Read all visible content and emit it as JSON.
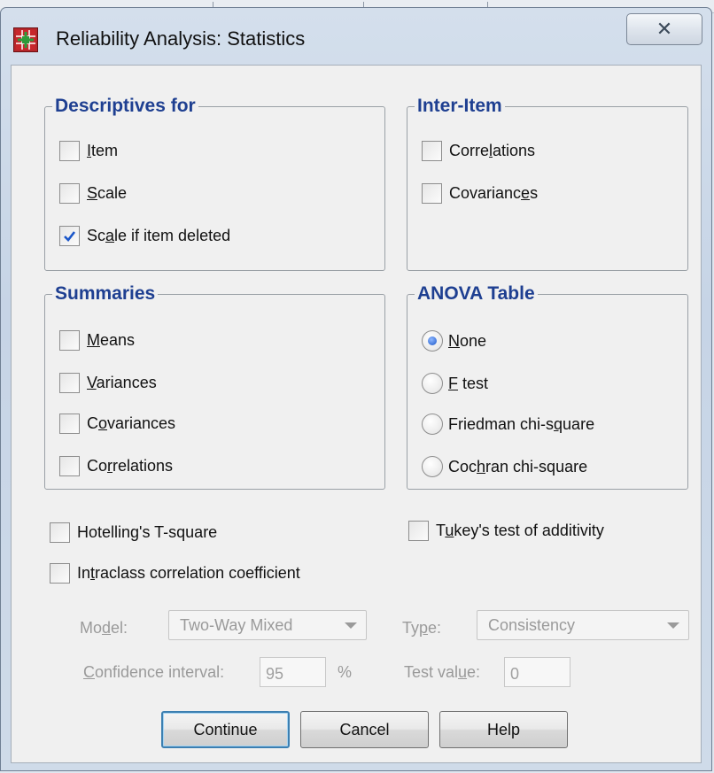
{
  "window": {
    "title": "Reliability Analysis: Statistics",
    "close_glyph": "✕"
  },
  "descriptives": {
    "title": "Descriptives for",
    "items": [
      {
        "label": "Item",
        "checked": false
      },
      {
        "label": "Scale",
        "checked": false
      },
      {
        "label": "Scale if item deleted",
        "checked": true
      }
    ]
  },
  "inter_item": {
    "title": "Inter-Item",
    "items": [
      {
        "label": "Correlations",
        "checked": false
      },
      {
        "label": "Covariances",
        "checked": false
      }
    ]
  },
  "summaries": {
    "title": "Summaries",
    "items": [
      {
        "label": "Means",
        "checked": false
      },
      {
        "label": "Variances",
        "checked": false
      },
      {
        "label": "Covariances",
        "checked": false
      },
      {
        "label": "Correlations",
        "checked": false
      }
    ]
  },
  "anova": {
    "title": "ANOVA Table",
    "options": [
      {
        "label": "None",
        "selected": true
      },
      {
        "label": "F test",
        "selected": false
      },
      {
        "label": "Friedman chi-square",
        "selected": false
      },
      {
        "label": "Cochran chi-square",
        "selected": false
      }
    ]
  },
  "extra": {
    "hotelling": {
      "label": "Hotelling's T-square",
      "checked": false
    },
    "tukey": {
      "label": "Tukey's test of additivity",
      "checked": false
    },
    "intraclass": {
      "label": "Intraclass correlation coefficient",
      "checked": false
    }
  },
  "icc": {
    "model_label": "Model:",
    "model_value": "Two-Way Mixed",
    "type_label": "Type:",
    "type_value": "Consistency",
    "ci_label": "Confidence interval:",
    "ci_value": "95",
    "ci_unit": "%",
    "test_value_label": "Test value:",
    "test_value": "0"
  },
  "buttons": {
    "continue": "Continue",
    "cancel": "Cancel",
    "help": "Help"
  },
  "colors": {
    "legend": "#1e3f91",
    "check": "#1a56c9",
    "disabled_text": "#9a9a9a"
  }
}
